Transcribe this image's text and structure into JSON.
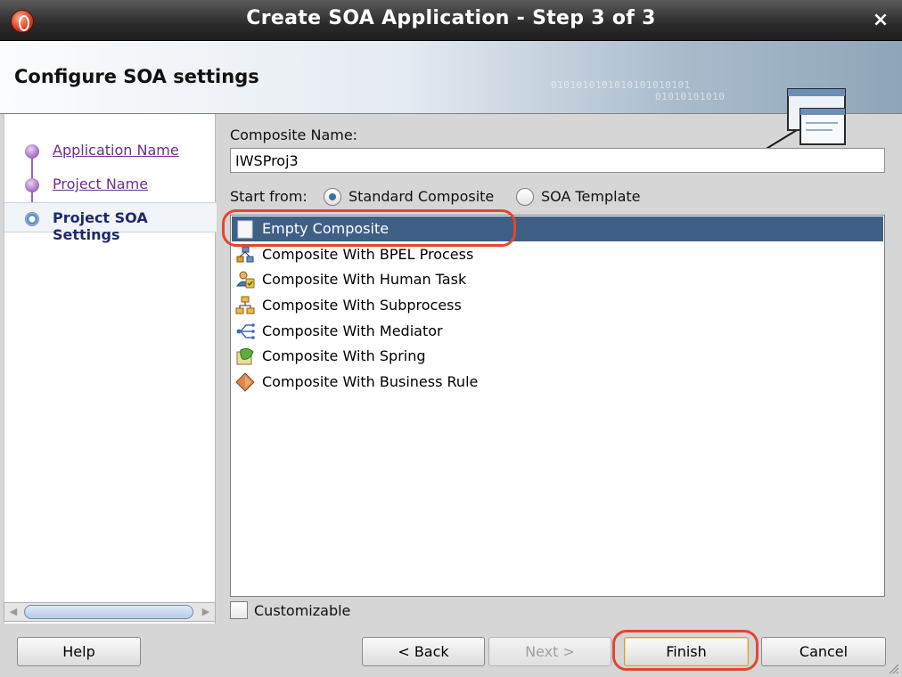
{
  "window": {
    "title": "Create SOA Application - Step 3 of 3",
    "close_glyph": "×"
  },
  "header": {
    "title": "Configure SOA settings",
    "binary_text_1": "0101010101010101010101",
    "binary_text_2": "01010101010"
  },
  "nav": {
    "items": [
      {
        "label": "Application Name",
        "state": "visited"
      },
      {
        "label": "Project Name",
        "state": "visited"
      },
      {
        "label": "Project SOA Settings",
        "state": "current"
      }
    ]
  },
  "form": {
    "composite_name_label": "Composite Name:",
    "composite_name_value": "IWSProj3",
    "start_from_label": "Start from:",
    "radio_standard": "Standard Composite",
    "radio_template": "SOA Template",
    "selected_option": "Standard Composite",
    "templates": [
      {
        "label": "Empty Composite",
        "icon": "empty-composite-icon",
        "selected": true
      },
      {
        "label": "Composite With BPEL Process",
        "icon": "bpel-process-icon"
      },
      {
        "label": "Composite With Human Task",
        "icon": "human-task-icon"
      },
      {
        "label": "Composite With Subprocess",
        "icon": "subprocess-icon"
      },
      {
        "label": "Composite With Mediator",
        "icon": "mediator-icon"
      },
      {
        "label": "Composite With Spring",
        "icon": "spring-icon"
      },
      {
        "label": "Composite With Business Rule",
        "icon": "business-rule-icon"
      }
    ],
    "customizable_label": "Customizable",
    "customizable_checked": false
  },
  "buttons": {
    "help": "Help",
    "back": "< Back",
    "next": "Next >",
    "finish": "Finish",
    "cancel": "Cancel"
  },
  "colors": {
    "selection": "#3f5f87",
    "annotation": "#e2472d",
    "nav_link": "#6a2f8f"
  }
}
